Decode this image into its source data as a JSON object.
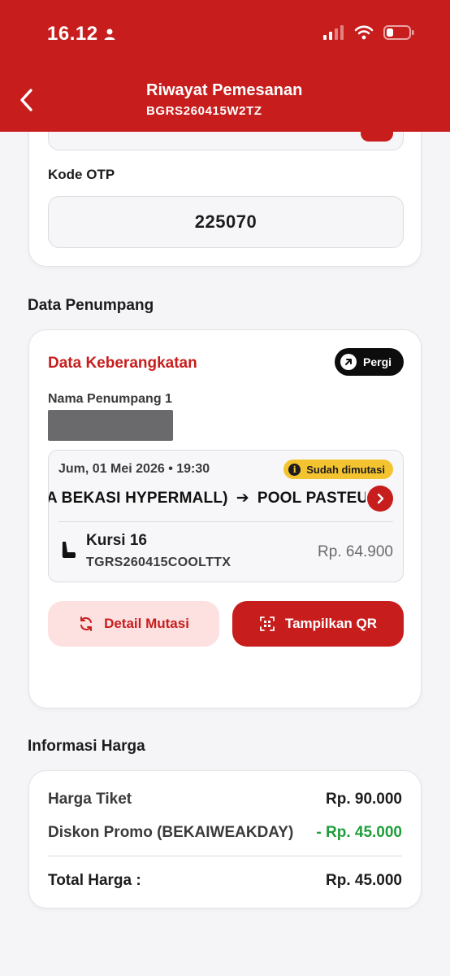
{
  "status_bar": {
    "time": "16.12"
  },
  "header": {
    "title": "Riwayat Pemesanan",
    "booking_code": "BGRS260415W2TZ"
  },
  "otp": {
    "label": "Kode OTP",
    "value": "225070"
  },
  "passenger_section": {
    "title": "Data Penumpang",
    "departure_title": "Data Keberangkatan",
    "direction_badge": "Pergi",
    "passenger_label": "Nama Penumpang 1",
    "trip": {
      "datetime": "Jum, 01 Mei 2026 • 19:30",
      "status_badge": "Sudah dimutasi",
      "route_from": "GA BEKASI HYPERMALL)",
      "route_arrow": "➔",
      "route_to": "POOL PASTEUR",
      "seat": "Kursi 16",
      "ticket_code": "TGRS260415COOLTTX",
      "price": "Rp. 64.900"
    },
    "buttons": {
      "detail_mutasi": "Detail Mutasi",
      "show_qr": "Tampilkan QR"
    }
  },
  "price_section": {
    "title": "Informasi Harga",
    "ticket_price_label": "Harga Tiket",
    "ticket_price_value": "Rp. 90.000",
    "discount_label": "Diskon Promo (BEKAIWEAKDAY)",
    "discount_value": "- Rp. 45.000",
    "total_label": "Total Harga :",
    "total_value": "Rp. 45.000"
  },
  "colors": {
    "primary": "#c81d1d",
    "badge_yellow": "#f4c430",
    "discount_green": "#1e9e3a"
  }
}
